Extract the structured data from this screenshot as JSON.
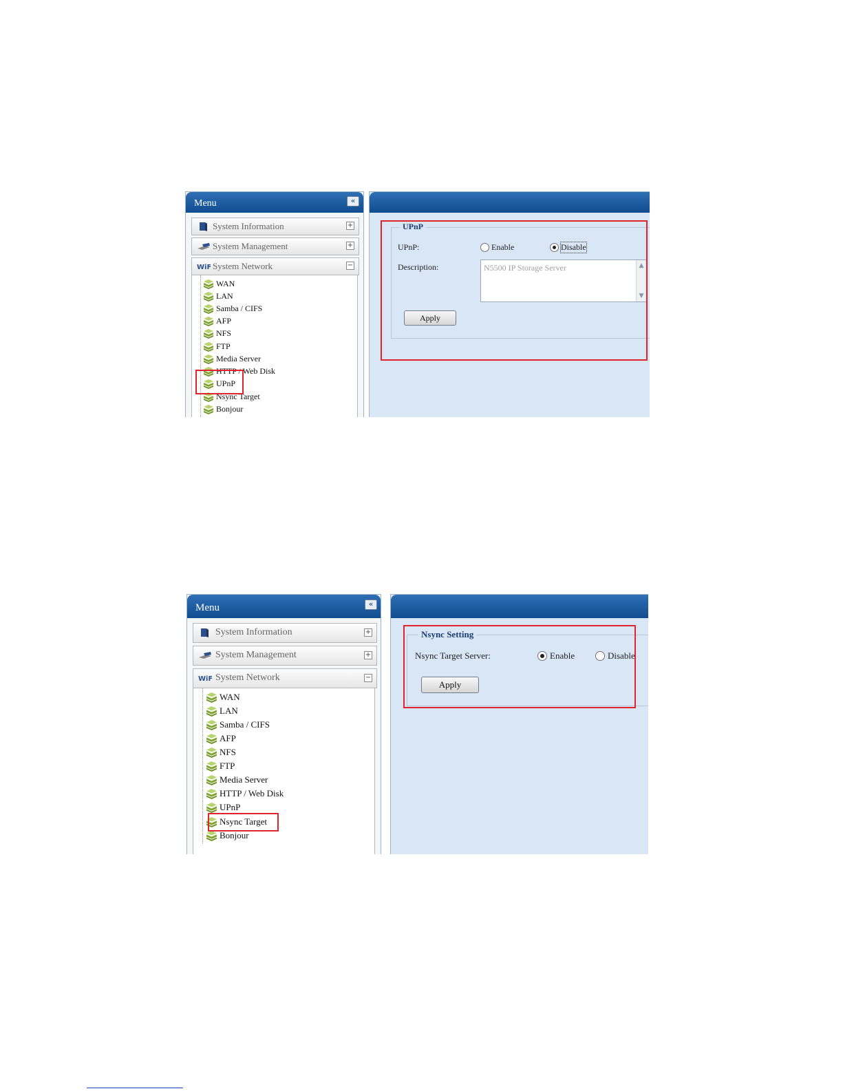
{
  "screens": [
    {
      "menu": {
        "title": "Menu",
        "collapse_icon": "double-chevron-left-icon",
        "sections": [
          {
            "label": "System Information",
            "icon": "info-book-icon",
            "toggle": "+"
          },
          {
            "label": "System Management",
            "icon": "management-icon",
            "toggle": "+"
          },
          {
            "label": "System Network",
            "icon": "network-icon",
            "toggle": "−"
          }
        ],
        "items": [
          "WAN",
          "LAN",
          "Samba / CIFS",
          "AFP",
          "NFS",
          "FTP",
          "Media Server",
          "HTTP / Web Disk",
          "UPnP",
          "Nsync Target",
          "Bonjour"
        ],
        "highlighted_item": "UPnP"
      },
      "form": {
        "legend": "UPnP",
        "rows": [
          {
            "label": "UPnP:",
            "options": [
              "Enable",
              "Disable"
            ],
            "selected": "Disable"
          },
          {
            "label": "Description:",
            "value": "N5500 IP Storage Server"
          }
        ],
        "apply_label": "Apply"
      }
    },
    {
      "menu": {
        "title": "Menu",
        "collapse_icon": "double-chevron-left-icon",
        "sections": [
          {
            "label": "System Information",
            "icon": "info-book-icon",
            "toggle": "+"
          },
          {
            "label": "System Management",
            "icon": "management-icon",
            "toggle": "+"
          },
          {
            "label": "System Network",
            "icon": "network-icon",
            "toggle": "−"
          }
        ],
        "items": [
          "WAN",
          "LAN",
          "Samba / CIFS",
          "AFP",
          "NFS",
          "FTP",
          "Media Server",
          "HTTP / Web Disk",
          "UPnP",
          "Nsync Target",
          "Bonjour"
        ],
        "highlighted_item": "Nsync Target"
      },
      "form": {
        "legend": "Nsync Setting",
        "rows": [
          {
            "label": "Nsync Target Server:",
            "options": [
              "Enable",
              "Disable"
            ],
            "selected": "Enable"
          }
        ],
        "apply_label": "Apply"
      }
    }
  ],
  "colors": {
    "header_blue": "#0f4c8f",
    "content_bg": "#d9e6f6",
    "highlight_red": "#e0242c",
    "legend_text": "#1a3d73",
    "cube_green": "#8db33a"
  }
}
